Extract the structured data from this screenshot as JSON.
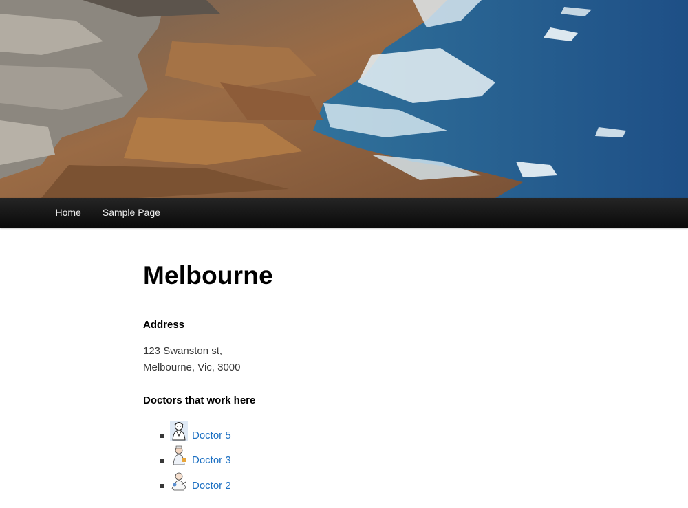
{
  "nav": {
    "items": [
      {
        "label": "Home"
      },
      {
        "label": "Sample Page"
      }
    ]
  },
  "page": {
    "title": "Melbourne"
  },
  "address": {
    "heading": "Address",
    "line1": "123 Swanston st,",
    "line2": "Melbourne, Vic, 3000"
  },
  "doctors": {
    "heading": "Doctors that work here",
    "items": [
      {
        "name": "Doctor 5",
        "icon": "doctor-cartoon-icon"
      },
      {
        "name": "Doctor 3",
        "icon": "doctor-cartoon-icon"
      },
      {
        "name": "Doctor 2",
        "icon": "doctor-cartoon-icon"
      }
    ]
  },
  "colors": {
    "link": "#1b6fc2",
    "nav_bg": "#111111"
  }
}
